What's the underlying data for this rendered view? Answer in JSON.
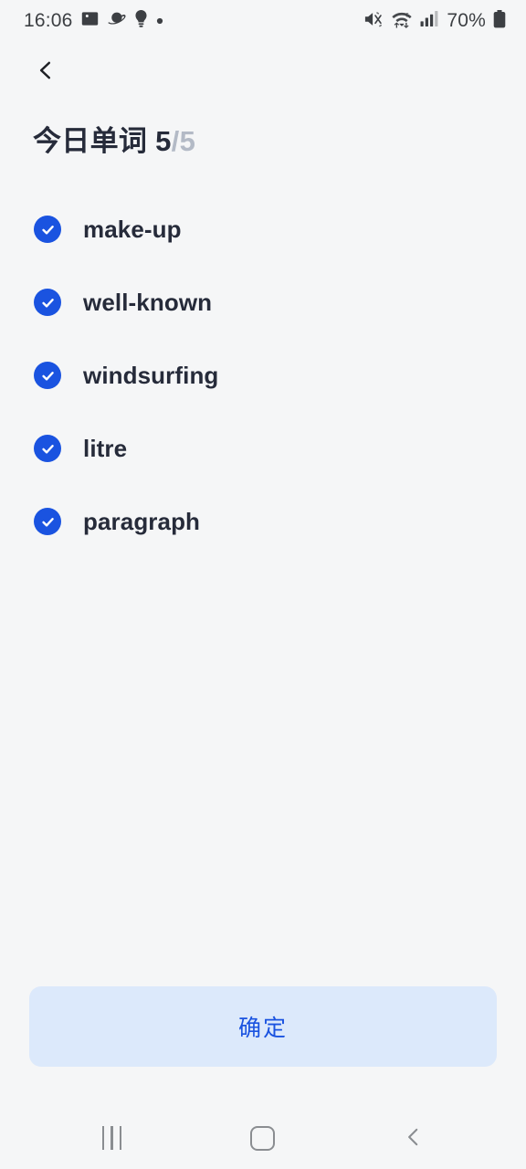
{
  "status_bar": {
    "time": "16:06",
    "left_icons": [
      "image-icon",
      "saturn-icon",
      "lightbulb-icon",
      "dot-icon"
    ],
    "right_icons": [
      "mute-icon",
      "wifi-transfer-icon",
      "cellular-signal-icon"
    ],
    "battery_percent": "70%",
    "battery_icon": "battery-icon"
  },
  "topbar": {
    "back_icon": "chevron-left-icon",
    "back_label": "返回"
  },
  "header": {
    "title_text": "今日单词",
    "count_done": "5",
    "count_separator": "/",
    "count_total": "5",
    "full_title": "今日单词 5/5"
  },
  "words": [
    {
      "label": "make-up",
      "checked": true,
      "check_icon": "check-icon"
    },
    {
      "label": "well-known",
      "checked": true,
      "check_icon": "check-icon"
    },
    {
      "label": "windsurfing",
      "checked": true,
      "check_icon": "check-icon"
    },
    {
      "label": "litre",
      "checked": true,
      "check_icon": "check-icon"
    },
    {
      "label": "paragraph",
      "checked": true,
      "check_icon": "check-icon"
    }
  ],
  "confirm": {
    "label": "确定"
  },
  "nav_bar": {
    "recents_label": "recents-icon",
    "home_label": "home-icon",
    "back_label": "back-icon"
  },
  "colors": {
    "background": "#f5f6f7",
    "accent_blue": "#1a53e0",
    "button_bg": "#dce9fb",
    "text_dark": "#262b3a",
    "text_muted": "#b3bac6",
    "nav_gray": "#8a8d91",
    "status_gray": "#3c3f43"
  }
}
